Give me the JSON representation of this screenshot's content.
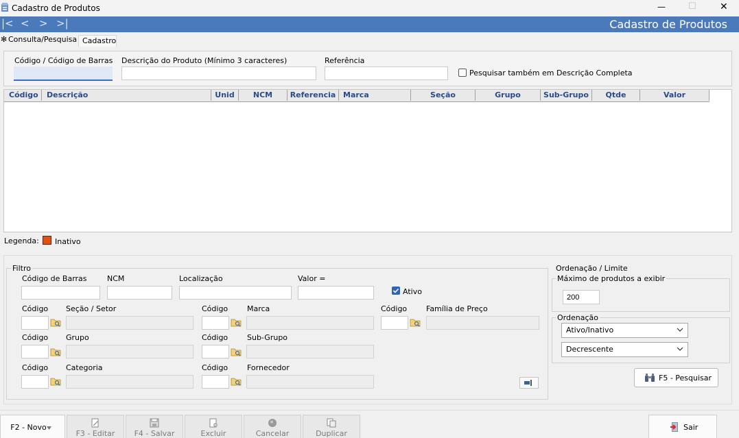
{
  "window": {
    "title": "Cadastro de Produtos",
    "minimize_glyph": "—",
    "maximize_glyph": "☐",
    "close_glyph": "✕"
  },
  "header": {
    "title": "Cadastro de Produtos",
    "bg_color": "#4a7ab9",
    "nav": [
      "|<",
      "<",
      ">",
      ">|"
    ]
  },
  "tabs": [
    {
      "label": "Consulta/Pesquisa",
      "active": true
    },
    {
      "label": "Cadastro",
      "active": false
    }
  ],
  "search": {
    "codigo_label": "Código / Código de Barras",
    "descricao_label": "Descrição do Produto (Mínimo 3 caracteres)",
    "referencia_label": "Referência",
    "checkbox_label": "Pesquisar também em Descrição Completa",
    "codigo_value": "",
    "descricao_value": "",
    "referencia_value": ""
  },
  "table": {
    "columns": [
      "Código",
      "Descrição",
      "Unid",
      "NCM",
      "Referencia",
      "Marca",
      "Seção",
      "Grupo",
      "Sub-Grupo",
      "Qtde",
      "Valor"
    ],
    "header_text_color": "#2a4a8a",
    "rows": []
  },
  "legend": {
    "label": "Legenda:",
    "inativo_label": "Inativo",
    "inativo_color": "#e0520e"
  },
  "filtro": {
    "title": "Filtro",
    "codigo_barras_label": "Código de Barras",
    "ncm_label": "NCM",
    "localizacao_label": "Localização",
    "valor_label": "Valor =",
    "ativo_label": "Ativo",
    "ativo_checked": true,
    "codigo_label": "Código",
    "secao_label": "Seção / Setor",
    "marca_label": "Marca",
    "familia_label": "Família de Preço",
    "grupo_label": "Grupo",
    "subgrupo_label": "Sub-Grupo",
    "categoria_label": "Categoria",
    "fornecedor_label": "Fornecedor"
  },
  "ordenacao": {
    "title": "Ordenação / Limite",
    "maximo_label": "Máximo de produtos a exibir",
    "maximo_value": "200",
    "ordenacao_label": "Ordenação",
    "order_field": "Ativo/Inativo",
    "order_direction": "Decrescente",
    "pesquisar_label": "F5 - Pesquisar"
  },
  "bottom": {
    "novo_label": "F2 - Novo",
    "editar_label": "F3 - Editar",
    "salvar_label": "F4 - Salvar",
    "excluir_label": "Excluir",
    "cancelar_label": "Cancelar",
    "duplicar_label": "Duplicar",
    "sair_label": "Sair"
  }
}
